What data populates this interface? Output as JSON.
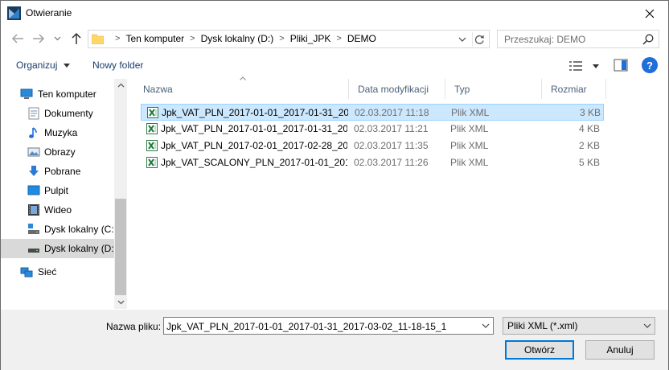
{
  "window": {
    "title": "Otwieranie"
  },
  "nav": {
    "breadcrumbs": [
      "Ten komputer",
      "Dysk lokalny (D:)",
      "Pliki_JPK",
      "DEMO"
    ],
    "search_placeholder": "Przeszukaj: DEMO"
  },
  "toolbar": {
    "organize_label": "Organizuj",
    "new_folder_label": "Nowy folder",
    "help_label": "?"
  },
  "sidebar": {
    "items": [
      {
        "label": "Ten komputer",
        "icon": "computer-icon"
      },
      {
        "label": "Dokumenty",
        "icon": "documents-icon"
      },
      {
        "label": "Muzyka",
        "icon": "music-icon"
      },
      {
        "label": "Obrazy",
        "icon": "pictures-icon"
      },
      {
        "label": "Pobrane",
        "icon": "downloads-icon"
      },
      {
        "label": "Pulpit",
        "icon": "desktop-icon"
      },
      {
        "label": "Wideo",
        "icon": "video-icon"
      },
      {
        "label": "Dysk lokalny (C:)",
        "icon": "drive-c-icon"
      },
      {
        "label": "Dysk lokalny (D:)",
        "icon": "drive-d-icon",
        "selected": true
      },
      {
        "label": "Sieć",
        "icon": "network-icon"
      }
    ]
  },
  "filelist": {
    "columns": [
      "Nazwa",
      "Data modyfikacji",
      "Typ",
      "Rozmiar"
    ],
    "rows": [
      {
        "name": "Jpk_VAT_PLN_2017-01-01_2017-01-31_20...",
        "date": "02.03.2017 11:18",
        "type": "Plik XML",
        "size": "3 KB",
        "selected": true
      },
      {
        "name": "Jpk_VAT_PLN_2017-01-01_2017-01-31_20...",
        "date": "02.03.2017 11:21",
        "type": "Plik XML",
        "size": "4 KB"
      },
      {
        "name": "Jpk_VAT_PLN_2017-02-01_2017-02-28_20...",
        "date": "02.03.2017 11:35",
        "type": "Plik XML",
        "size": "2 KB"
      },
      {
        "name": "Jpk_VAT_SCALONY_PLN_2017-01-01_201...",
        "date": "02.03.2017 11:26",
        "type": "Plik XML",
        "size": "5 KB"
      }
    ]
  },
  "bottom": {
    "filename_label": "Nazwa pliku:",
    "filename_value": "Jpk_VAT_PLN_2017-01-01_2017-01-31_2017-03-02_11-18-15_1",
    "filter_value": "Pliki XML (*.xml)",
    "open_label": "Otwórz",
    "cancel_label": "Anuluj"
  },
  "colors": {
    "accent": "#0078d7",
    "selection": "#cce8ff",
    "link": "#1a3e6b"
  }
}
